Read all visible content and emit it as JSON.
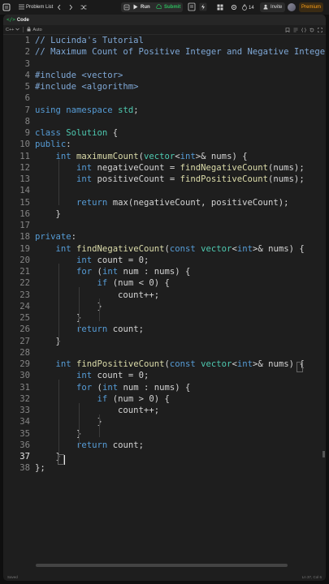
{
  "topbar": {
    "problem_list": "Problem List",
    "run": "Run",
    "submit": "Submit",
    "streak": "14",
    "invite": "Invite",
    "premium": "Premium"
  },
  "editor": {
    "tab_label": "Code",
    "language": "C++",
    "mode": "Auto"
  },
  "code_lines": [
    "// Lucinda's Tutorial",
    "// Maximum Count of Positive Integer and Negative Integer",
    "",
    "#include <vector>",
    "#include <algorithm>",
    "",
    "using namespace std;",
    "",
    "class Solution {",
    "public:",
    "    int maximumCount(vector<int>& nums) {",
    "        int negativeCount = findNegativeCount(nums);",
    "        int positiveCount = findPositiveCount(nums);",
    "",
    "        return max(negativeCount, positiveCount);",
    "    }",
    "",
    "private:",
    "    int findNegativeCount(const vector<int>& nums) {",
    "        int count = 0;",
    "        for (int num : nums) {",
    "            if (num < 0) {",
    "                count++;",
    "            }",
    "        }",
    "        return count;",
    "    }",
    "",
    "    int findPositiveCount(const vector<int>& nums) {",
    "        int count = 0;",
    "        for (int num : nums) {",
    "            if (num > 0) {",
    "                count++;",
    "            }",
    "        }",
    "        return count;",
    "    }",
    "};"
  ],
  "current_line": 37,
  "status": {
    "saved": "Saved",
    "cursor": "Ln 37, Col 6"
  },
  "colors": {
    "keyword": "#569cd6",
    "type": "#4ec9b0",
    "function": "#dcdcaa",
    "comment": "#7fa8d6",
    "run_green": "#2cbb5d",
    "premium_orange": "#ffa116"
  }
}
